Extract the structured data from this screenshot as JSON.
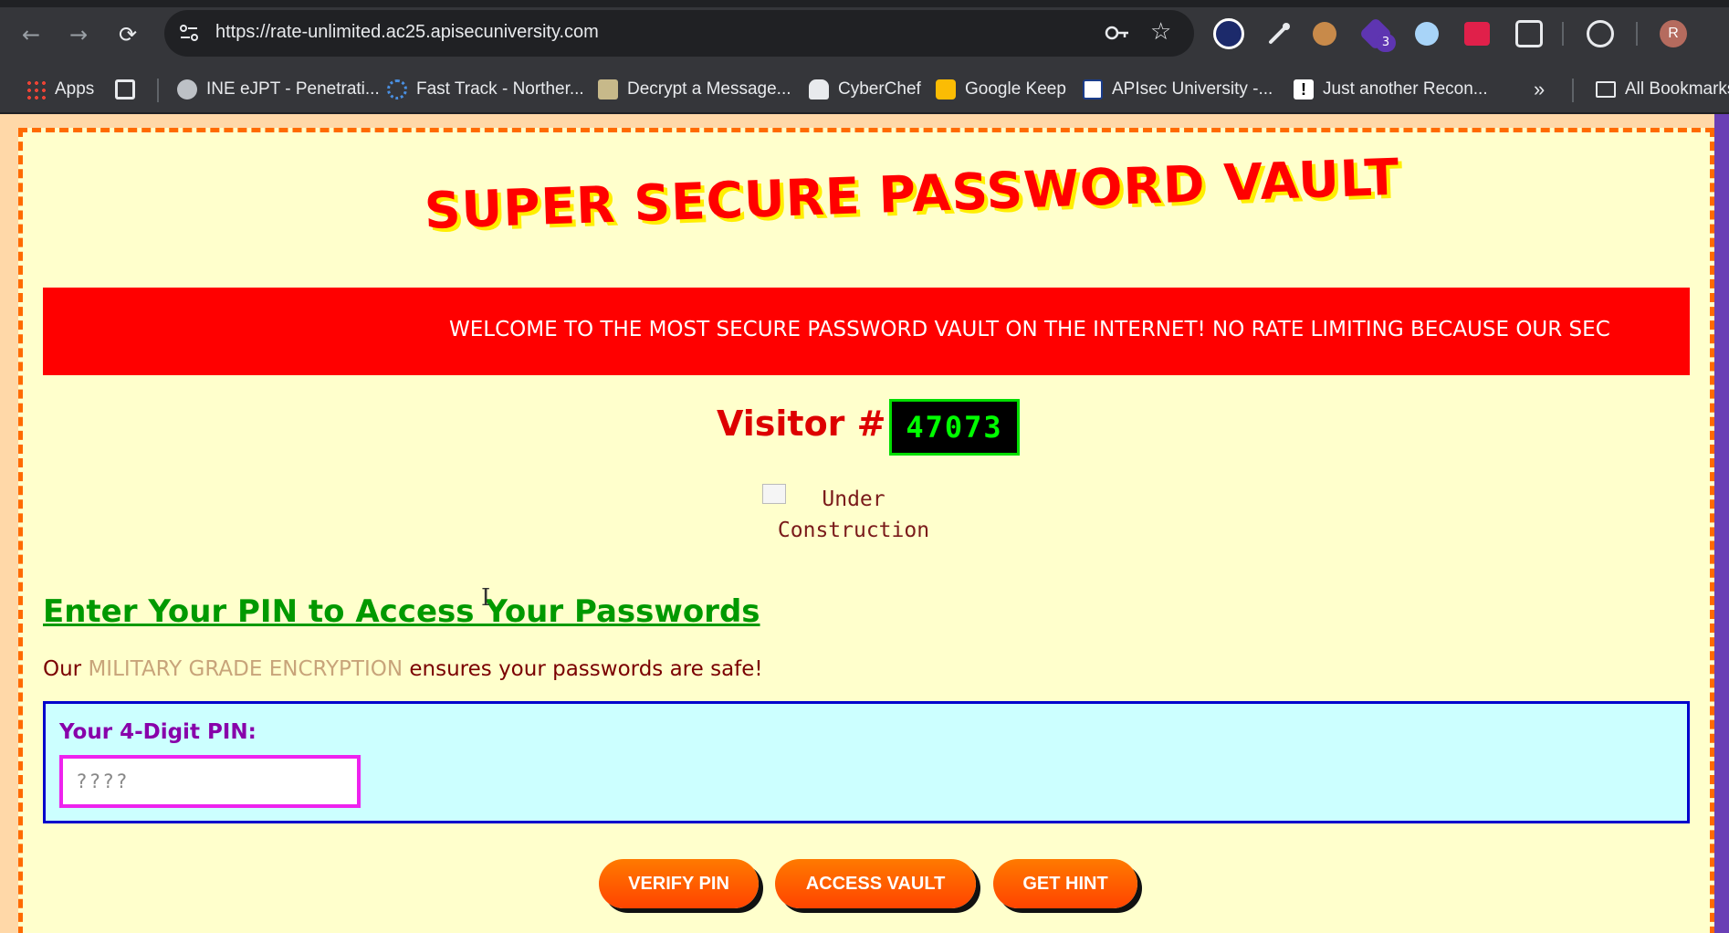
{
  "browser": {
    "url": "https://rate-unlimited.ac25.apisecuniversity.com",
    "profile_initial": "R",
    "extension_badge": "3",
    "bookmarks": [
      {
        "label": "Apps",
        "icon": "apps-grid-icon"
      },
      {
        "label": "INE eJPT - Penetrati...",
        "icon": "globe-icon"
      },
      {
        "label": "Fast Track - Norther...",
        "icon": "gear-star-icon"
      },
      {
        "label": "Decrypt a Message...",
        "icon": "image-icon"
      },
      {
        "label": "CyberChef",
        "icon": "chef-hat-icon"
      },
      {
        "label": "Google Keep",
        "icon": "keep-icon"
      },
      {
        "label": "APIsec University -...",
        "icon": "apisec-icon"
      },
      {
        "label": "Just another Recon...",
        "icon": "exclamation-icon"
      },
      {
        "label": "All Bookmarks",
        "icon": "folder-icon"
      }
    ],
    "more_bookmarks": "»"
  },
  "page": {
    "title": "SUPER SECURE PASSWORD VAULT",
    "marquee": "WELCOME TO THE MOST SECURE PASSWORD VAULT ON THE INTERNET! NO RATE LIMITING BECAUSE OUR SEC",
    "visitor_label": "Visitor #:",
    "visitor_count": "47073",
    "image_alt_line1": "Under",
    "image_alt_line2": "Construction",
    "section_heading": "Enter Your PIN to Access Your Passwords",
    "section_text_before": "Our ",
    "section_text_highlight": "MILITARY GRADE ENCRYPTION",
    "section_text_after": " ensures your passwords are safe!",
    "pin_label": "Your 4-Digit PIN:",
    "pin_placeholder": "????",
    "pin_value": "",
    "buttons": {
      "verify": "VERIFY PIN",
      "access": "ACCESS VAULT",
      "hint": "GET HINT"
    }
  },
  "colors": {
    "title": "#ff0000",
    "marquee_bg": "#ff0000",
    "counter_text": "#00ff00",
    "heading": "#009900",
    "button": "#ff5500"
  }
}
